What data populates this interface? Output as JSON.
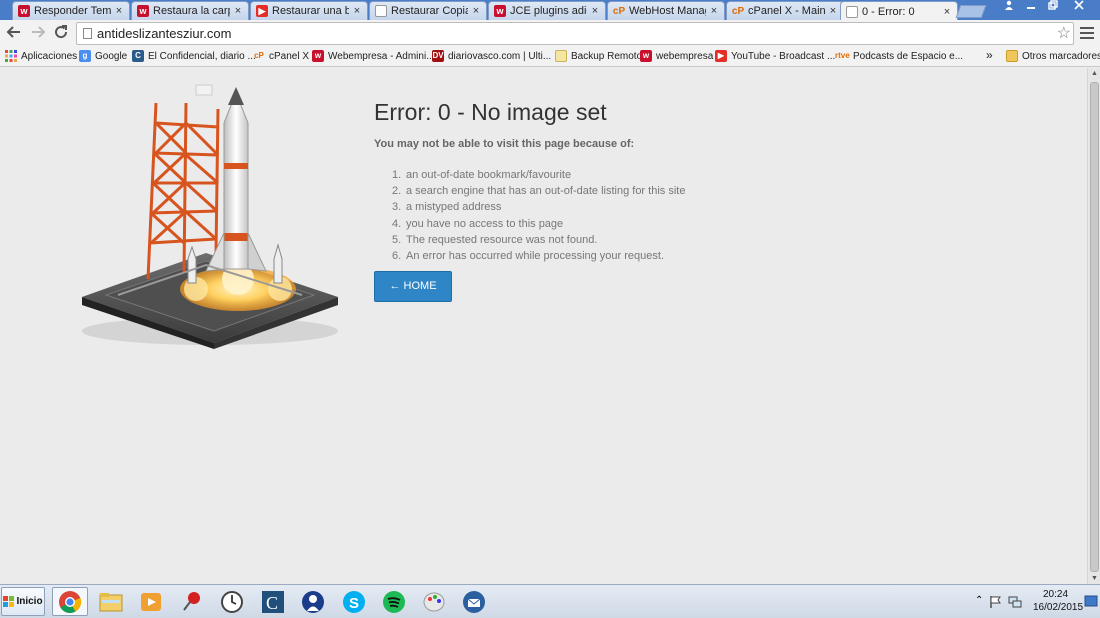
{
  "tabs": [
    {
      "label": "Responder Tema: a",
      "favicon": "webempresa-icon"
    },
    {
      "label": "Restaura la carpeta",
      "favicon": "webempresa-icon"
    },
    {
      "label": "Restaurar una base",
      "favicon": "youtube-icon"
    },
    {
      "label": "Restaurar Copia cp",
      "favicon": "document-icon"
    },
    {
      "label": "JCE plugins adicion",
      "favicon": "webempresa-icon"
    },
    {
      "label": "WebHost Manager",
      "favicon": "cpanel-icon"
    },
    {
      "label": "cPanel X - Main",
      "favicon": "cpanel-icon"
    },
    {
      "label": "0 - Error: 0",
      "favicon": "document-icon",
      "active": true
    }
  ],
  "tab_close_glyph": "×",
  "address_bar": {
    "url": "antideslizantesziur.com"
  },
  "bookmarks": [
    {
      "label": "Aplicaciones",
      "icon": "apps-grid-icon"
    },
    {
      "label": "Google",
      "icon": "google-icon"
    },
    {
      "label": "El Confidencial, diario ...",
      "icon": "confidencial-icon"
    },
    {
      "label": "cPanel X",
      "icon": "cpanel-icon"
    },
    {
      "label": "Webempresa - Admini...",
      "icon": "webempresa-icon"
    },
    {
      "label": "diariovasco.com | Ulti...",
      "icon": "diariovasco-icon"
    },
    {
      "label": "Backup Remoto",
      "icon": "bookmark-page-icon"
    },
    {
      "label": "webempresa",
      "icon": "webempresa-icon"
    },
    {
      "label": "YouTube - Broadcast ...",
      "icon": "youtube-icon"
    },
    {
      "label": "Podcasts de Espacio e...",
      "icon": "rtve-icon"
    }
  ],
  "bookmarks_overflow": "»",
  "other_bookmarks": "Otros marcadores",
  "error_page": {
    "title": "Error: 0 - No image set",
    "subtitle": "You may not be able to visit this page because of:",
    "reasons": [
      {
        "num": "1.",
        "text": "an out-of-date bookmark/favourite"
      },
      {
        "num": "2.",
        "text": "a search engine that has an out-of-date listing for this site"
      },
      {
        "num": "3.",
        "text": "a mistyped address"
      },
      {
        "num": "4.",
        "text": "you have no access to this page"
      },
      {
        "num": "5.",
        "text": "The requested resource was not found."
      },
      {
        "num": "6.",
        "text": "An error has occurred while processing your request."
      }
    ],
    "home_button": "← HOME"
  },
  "taskbar": {
    "start_label": "Inicio",
    "time": "20:24",
    "date": "16/02/2015"
  },
  "colors": {
    "home_button": "#2f86c6",
    "tab_strip": "#4a7dc7",
    "page_bg": "#ebebeb"
  }
}
